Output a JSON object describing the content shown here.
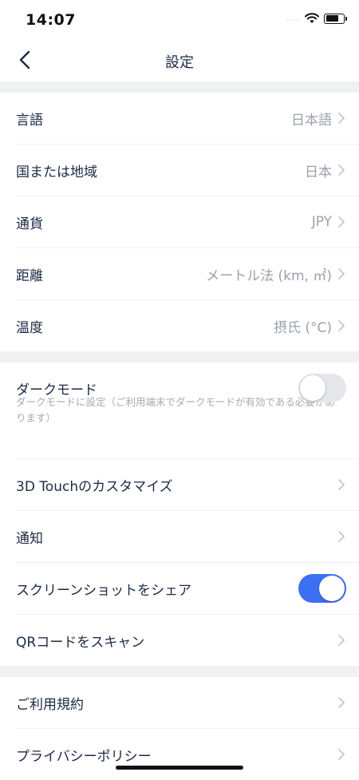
{
  "status_bar": {
    "time": "14:07",
    "signal": "....",
    "battery_level": 0.8
  },
  "nav": {
    "title": "設定"
  },
  "settings_region": [
    {
      "label": "言語",
      "value": "日本語"
    },
    {
      "label": "国または地域",
      "value": "日本"
    },
    {
      "label": "通貨",
      "value": "JPY"
    },
    {
      "label": "距離",
      "value": "メートル法 (km, ㎡)"
    },
    {
      "label": "温度",
      "value": "摂氏 (°C)"
    }
  ],
  "dark_mode": {
    "label": "ダークモード",
    "description": "ダークモードに設定（ご利用端末でダークモードが有効である必要があります）",
    "enabled": false
  },
  "settings_features": {
    "touch": "3D Touchのカスタマイズ",
    "notifications": "通知",
    "share_screenshot": {
      "label": "スクリーンショットをシェア",
      "enabled": true
    },
    "qr": "QRコードをスキャン"
  },
  "settings_legal": [
    {
      "label": "ご利用規約"
    },
    {
      "label": "プライバシーポリシー"
    }
  ],
  "colors": {
    "accent": "#3d6ff2",
    "text": "#1d2a44",
    "secondary": "#9aa1ad",
    "separator": "#f0f1f3"
  }
}
